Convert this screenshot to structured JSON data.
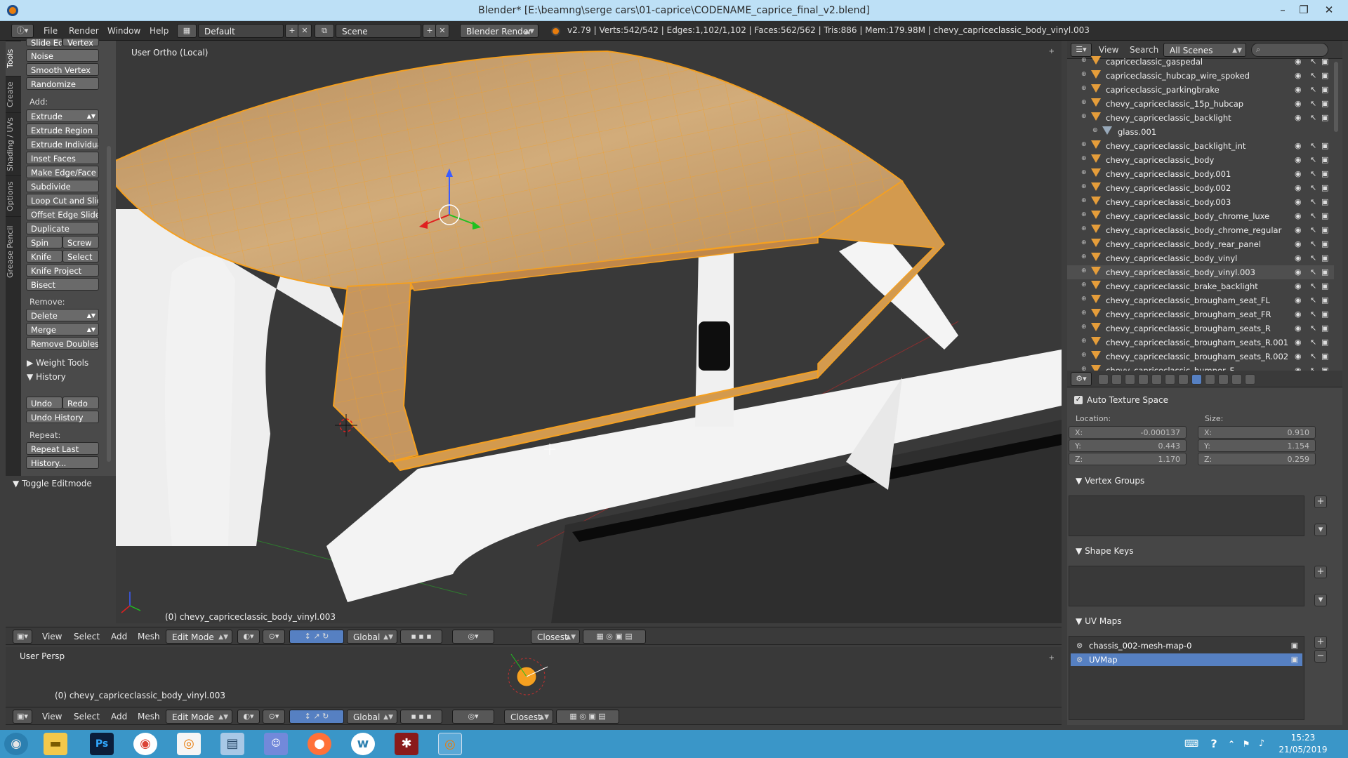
{
  "window": {
    "title": "Blender* [E:\\beamng\\serge cars\\01-caprice\\CODENAME_caprice_final_v2.blend]",
    "minimize": "–",
    "maximize": "❐",
    "close": "✕"
  },
  "info_header": {
    "menus": [
      "File",
      "Render",
      "Window",
      "Help"
    ],
    "layout": "Default",
    "scene": "Scene",
    "engine": "Blender Render",
    "stats": "v2.79 | Verts:542/542 | Edges:1,102/1,102 | Faces:562/562 | Tris:886 | Mem:179.98M | chevy_capriceclassic_body_vinyl.003"
  },
  "toolshelf": {
    "tabs": [
      "Tools",
      "Create",
      "Shading / UVs",
      "Options",
      "Grease Pencil"
    ],
    "top_partial": [
      "Slide Ed",
      "Vertex"
    ],
    "deform": [
      "Noise",
      "Smooth Vertex",
      "Randomize"
    ],
    "add_label": "Add:",
    "add": [
      "Extrude",
      "Extrude Region",
      "Extrude Individual",
      "Inset Faces",
      "Make Edge/Face",
      "Subdivide",
      "Loop Cut and Slide",
      "Offset Edge Slide",
      "Duplicate"
    ],
    "spin": "Spin",
    "screw": "Screw",
    "knife": "Knife",
    "select": "Select",
    "knife_project": "Knife Project",
    "bisect": "Bisect",
    "remove_label": "Remove:",
    "delete": "Delete",
    "merge": "Merge",
    "remove_doubles": "Remove Doubles",
    "weight_tools": "Weight Tools",
    "history": "History",
    "undo": "Undo",
    "redo": "Redo",
    "undo_history": "Undo History",
    "repeat_label": "Repeat:",
    "repeat_last": "Repeat Last",
    "history_dots": "History...",
    "toggle_editmode": "Toggle Editmode"
  },
  "viewport": {
    "view_label": "User Ortho (Local)",
    "object_label": "(0) chevy_capriceclassic_body_vinyl.003",
    "lower_view_label": "User Persp",
    "lower_object_label": "(0) chevy_capriceclassic_body_vinyl.003"
  },
  "view_header": {
    "menus": [
      "View",
      "Select",
      "Add",
      "Mesh"
    ],
    "mode": "Edit Mode",
    "orientation": "Global",
    "snap": "Closest"
  },
  "outliner": {
    "menus": [
      "View",
      "Search"
    ],
    "filter": "All Scenes",
    "rows": [
      {
        "name": "capriceclassic_gaspedal",
        "indent": false
      },
      {
        "name": "capriceclassic_hubcap_wire_spoked",
        "indent": false
      },
      {
        "name": "capriceclassic_parkingbrake",
        "indent": false
      },
      {
        "name": "chevy_capriceclassic_15p_hubcap",
        "indent": false
      },
      {
        "name": "chevy_capriceclassic_backlight",
        "indent": false
      },
      {
        "name": "glass.001",
        "indent": true
      },
      {
        "name": "chevy_capriceclassic_backlight_int",
        "indent": false
      },
      {
        "name": "chevy_capriceclassic_body",
        "indent": false
      },
      {
        "name": "chevy_capriceclassic_body.001",
        "indent": false
      },
      {
        "name": "chevy_capriceclassic_body.002",
        "indent": false
      },
      {
        "name": "chevy_capriceclassic_body.003",
        "indent": false
      },
      {
        "name": "chevy_capriceclassic_body_chrome_luxe",
        "indent": false
      },
      {
        "name": "chevy_capriceclassic_body_chrome_regular",
        "indent": false
      },
      {
        "name": "chevy_capriceclassic_body_rear_panel",
        "indent": false
      },
      {
        "name": "chevy_capriceclassic_body_vinyl",
        "indent": false
      },
      {
        "name": "chevy_capriceclassic_body_vinyl.003",
        "indent": false,
        "selected": true
      },
      {
        "name": "chevy_capriceclassic_brake_backlight",
        "indent": false
      },
      {
        "name": "chevy_capriceclassic_brougham_seat_FL",
        "indent": false
      },
      {
        "name": "chevy_capriceclassic_brougham_seat_FR",
        "indent": false
      },
      {
        "name": "chevy_capriceclassic_brougham_seats_R",
        "indent": false
      },
      {
        "name": "chevy_capriceclassic_brougham_seats_R.001",
        "indent": false
      },
      {
        "name": "chevy_capriceclassic_brougham_seats_R.002",
        "indent": false
      },
      {
        "name": "chevy_capriceclassic_bumper_F",
        "indent": false
      }
    ]
  },
  "properties": {
    "auto_texture_space": "Auto Texture Space",
    "location_label": "Location:",
    "size_label": "Size:",
    "location": [
      {
        "axis": "X:",
        "value": "-0.000137"
      },
      {
        "axis": "Y:",
        "value": "0.443"
      },
      {
        "axis": "Z:",
        "value": "1.170"
      }
    ],
    "size": [
      {
        "axis": "X:",
        "value": "0.910"
      },
      {
        "axis": "Y:",
        "value": "1.154"
      },
      {
        "axis": "Z:",
        "value": "0.259"
      }
    ],
    "vertex_groups": "Vertex Groups",
    "shape_keys": "Shape Keys",
    "uv_maps": "UV Maps",
    "uv_list": [
      {
        "name": "chassis_002-mesh-map-0",
        "selected": false
      },
      {
        "name": "UVMap",
        "selected": true
      }
    ]
  },
  "taskbar": {
    "time": "15:23",
    "date": "21/05/2019",
    "apps": [
      "start",
      "explorer",
      "photoshop",
      "chrome",
      "blender-launcher",
      "notepad",
      "discord",
      "firefox",
      "w-app",
      "game",
      "blender"
    ]
  },
  "colors": {
    "accent_selection": "#5680c2",
    "edit_orange": "#f5a020",
    "taskbar": "#3a96c8"
  }
}
